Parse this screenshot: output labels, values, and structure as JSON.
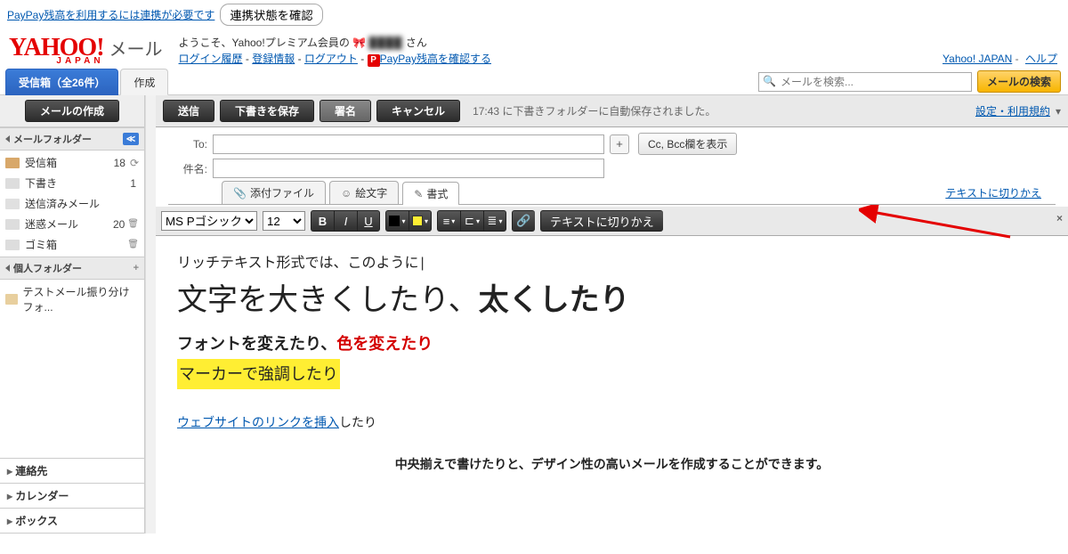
{
  "topbar": {
    "paypay_notice": "PayPay残高を利用するには連携が必要です",
    "check_link_btn": "連携状態を確認"
  },
  "logo": {
    "text": "YAHOO!",
    "japan": "JAPAN",
    "mail": "メール"
  },
  "welcome": {
    "line1_prefix": "ようこそ、Yahoo!プレミアム会員の",
    "line1_blur": "████",
    "line1_suffix": "さん",
    "login_history": "ログイン履歴",
    "reg_info": "登録情報",
    "logout": "ログアウト",
    "paypay_check": "PayPay残高を確認する"
  },
  "header_right": {
    "yahoo_japan": "Yahoo! JAPAN",
    "help": "ヘルプ"
  },
  "tabs": {
    "inbox_label": "受信箱（全26件）",
    "compose_label": "作成"
  },
  "search": {
    "placeholder": "メールを検索...",
    "button": "メールの検索"
  },
  "compose_btn": "メールの作成",
  "sidebar": {
    "mail_folder_hdr": "メールフォルダー",
    "personal_folder_hdr": "個人フォルダー",
    "items_mail": [
      {
        "label": "受信箱",
        "count": "18",
        "icon": "inbox",
        "reload": true
      },
      {
        "label": "下書き",
        "count": "1",
        "icon": "draft"
      },
      {
        "label": "送信済みメール",
        "count": "",
        "icon": "sent"
      },
      {
        "label": "迷惑メール",
        "count": "20",
        "icon": "spam",
        "trash": true
      },
      {
        "label": "ゴミ箱",
        "count": "",
        "icon": "trash",
        "trash": true
      }
    ],
    "items_personal": [
      {
        "label": "テストメール振り分けフォ...",
        "icon": "folder"
      }
    ],
    "bottom": [
      {
        "label": "連絡先"
      },
      {
        "label": "カレンダー"
      },
      {
        "label": "ボックス"
      }
    ]
  },
  "actionbar": {
    "send": "送信",
    "save_draft": "下書きを保存",
    "signature": "署名",
    "cancel": "キャンセル",
    "autosave": "17:43 に下書きフォルダーに自動保存されました。",
    "settings": "設定・利用規約"
  },
  "headers_labels": {
    "to": "To:",
    "subject": "件名:",
    "ccbcc": "Cc, Bcc欄を表示"
  },
  "attach_tabs": {
    "attach": "添付ファイル",
    "emoji": "絵文字",
    "format": "書式",
    "text_switch_link": "テキストに切りかえ"
  },
  "fmt": {
    "font": "MS Pゴシック",
    "size": "12",
    "text_switch": "テキストに切りかえ"
  },
  "editor": {
    "line1": "リッチテキスト形式では、このように",
    "big_a": "文字を大きくしたり、",
    "big_b": "太くしたり",
    "line3_a": "フォントを変えたり、",
    "line3_b": "色を変えたり",
    "line4": "マーカーで強調したり",
    "link": "ウェブサイトのリンクを挿入",
    "link_suffix": "したり",
    "center": "中央揃えで書けたりと、デザイン性の高いメールを作成することができます。"
  }
}
